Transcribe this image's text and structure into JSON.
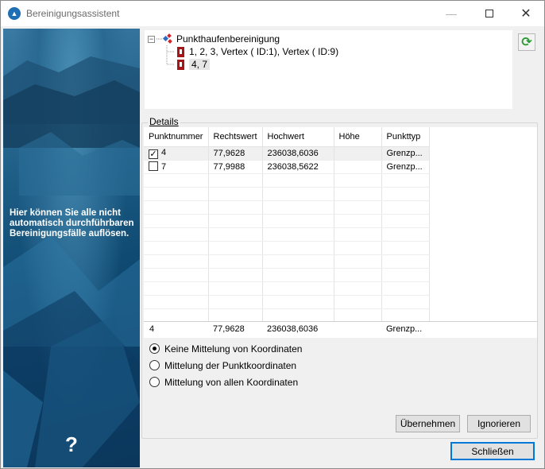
{
  "window": {
    "title": "Bereinigungsassistent",
    "icon": "app-logo-icon"
  },
  "sidebar": {
    "text": "Hier können Sie alle nicht automatisch durchführbaren Bereinigungsfälle auflösen.",
    "help": "?"
  },
  "tree": {
    "root": "Punkthaufenbereinigung",
    "children": [
      "1, 2, 3, Vertex ( ID:1), Vertex ( ID:9)",
      "4, 7"
    ]
  },
  "details": {
    "label": "Details",
    "columns": [
      "Punktnummer",
      "Rechtswert",
      "Hochwert",
      "Höhe",
      "Punkttyp"
    ],
    "rows": [
      {
        "checked": true,
        "cells": [
          "4",
          "77,9628",
          "236038,6036",
          "",
          "Grenzp..."
        ]
      },
      {
        "checked": false,
        "cells": [
          "7",
          "77,9988",
          "236038,5622",
          "",
          "Grenzp..."
        ]
      }
    ],
    "summary": [
      "4",
      "77,9628",
      "236038,6036",
      "",
      "Grenzp..."
    ]
  },
  "options": [
    {
      "label": "Keine Mittelung von Koordinaten",
      "selected": true
    },
    {
      "label": "Mittelung der Punktkoordinaten",
      "selected": false
    },
    {
      "label": "Mittelung von allen Koordinaten",
      "selected": false
    }
  ],
  "buttons": {
    "apply": "Übernehmen",
    "ignore": "Ignorieren",
    "close": "Schließen"
  }
}
